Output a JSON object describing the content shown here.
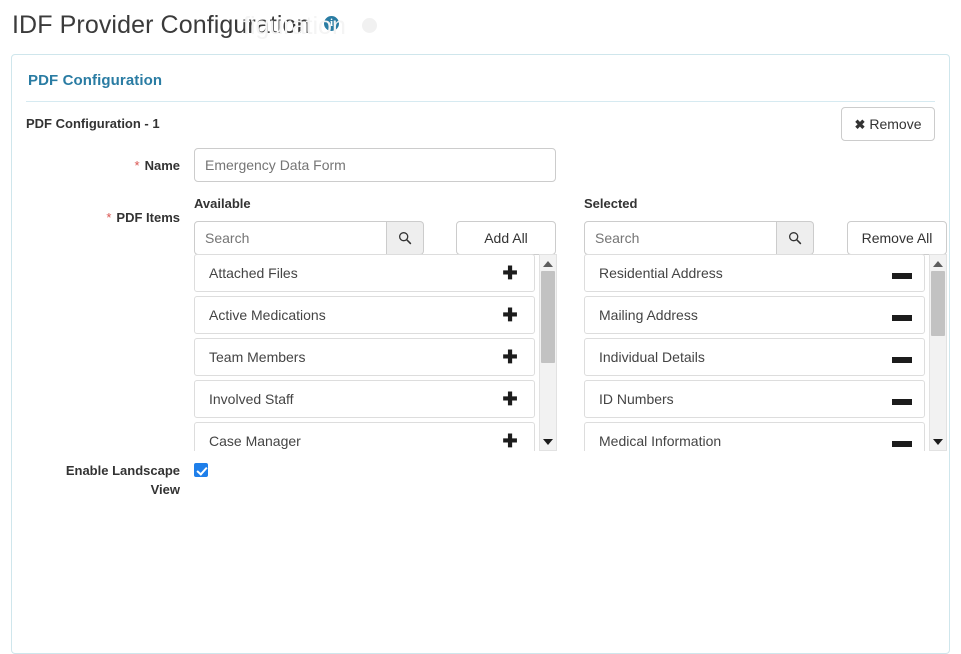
{
  "page": {
    "title": "IDF Provider Configuration",
    "info_icon": "info-icon",
    "ghost_title": "figuration"
  },
  "card": {
    "title": "PDF Configuration",
    "config_label": "PDF Configuration - 1",
    "remove_button": {
      "label": "Remove",
      "icon": "close-x-icon"
    }
  },
  "fields": {
    "name": {
      "label": "Name",
      "required_marker": "*",
      "value": "",
      "placeholder": "Emergency Data Form"
    },
    "pdf_items": {
      "label": "PDF Items",
      "required_marker": "*"
    },
    "landscape": {
      "label_line1": "Enable Landscape",
      "label_line2": "View",
      "checked": true
    }
  },
  "available": {
    "heading": "Available",
    "search": {
      "value": "",
      "placeholder": "Search",
      "icon": "search-icon"
    },
    "bulk_button": "Add All",
    "item_action_icon": "plus-icon",
    "items": [
      {
        "label": "Attached Files"
      },
      {
        "label": "Active Medications"
      },
      {
        "label": "Team Members"
      },
      {
        "label": "Involved Staff"
      },
      {
        "label": "Case Manager"
      }
    ],
    "scroll": {
      "thumb_top_pct": 8,
      "thumb_height_pct": 47
    }
  },
  "selected": {
    "heading": "Selected",
    "search": {
      "value": "",
      "placeholder": "Search",
      "icon": "search-icon"
    },
    "bulk_button": "Remove All",
    "item_action_icon": "minus-icon",
    "items": [
      {
        "label": "Residential Address"
      },
      {
        "label": "Mailing Address"
      },
      {
        "label": "Individual Details"
      },
      {
        "label": "ID Numbers"
      },
      {
        "label": "Medical Information"
      }
    ],
    "scroll": {
      "thumb_top_pct": 8,
      "thumb_height_pct": 33
    }
  },
  "colors": {
    "accent": "#2a7ca3",
    "card_border": "#cfe6ec",
    "required": "#d9534f",
    "checkbox": "#1f7fea"
  }
}
